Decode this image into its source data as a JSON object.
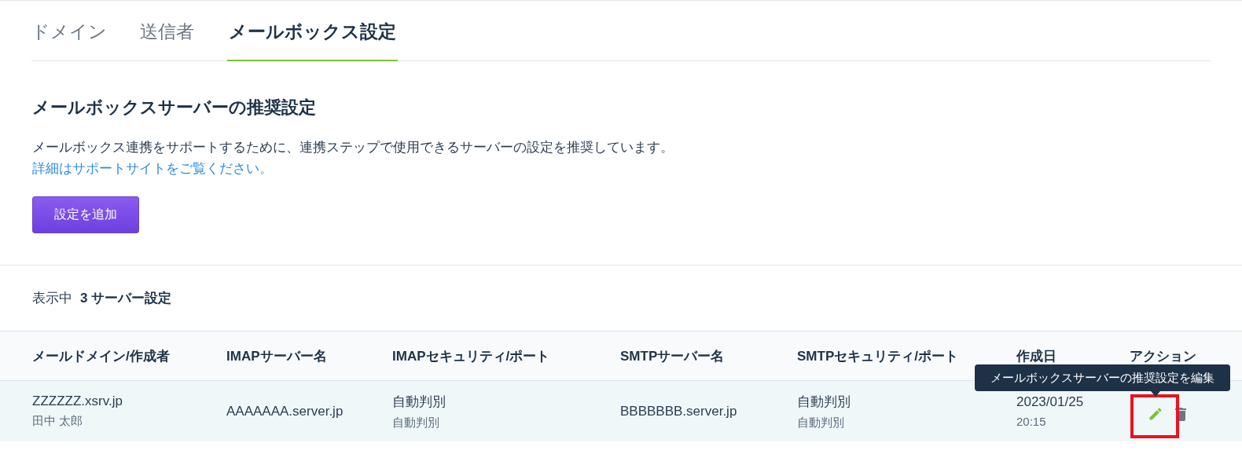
{
  "tabs": [
    {
      "label": "ドメイン",
      "selected": false
    },
    {
      "label": "送信者",
      "selected": false
    },
    {
      "label": "メールボックス設定",
      "selected": true
    }
  ],
  "section": {
    "title": "メールボックスサーバーの推奨設定",
    "description": "メールボックス連携をサポートするために、連携ステップで使用できるサーバーの設定を推奨しています。",
    "link": "詳細はサポートサイトをご覧ください。",
    "button": "設定を追加"
  },
  "count": {
    "label": "表示中",
    "value": "3 サーバー設定"
  },
  "table": {
    "columns": [
      "メールドメイン/作成者",
      "IMAPサーバー名",
      "IMAPセキュリティ/ポート",
      "SMTPサーバー名",
      "SMTPセキュリティ/ポート",
      "作成日",
      "アクション"
    ],
    "rows": [
      {
        "domain": "ZZZZZZ.xsrv.jp",
        "author": "田中 太郎",
        "imap_server": "AAAAAAA.server.jp",
        "imap_security": "自動判別",
        "imap_port": "自動判別",
        "smtp_server": "BBBBBBB.server.jp",
        "smtp_security": "自動判別",
        "smtp_port": "自動判別",
        "date": "2023/01/25",
        "time": "20:15",
        "highlighted": true
      }
    ]
  },
  "tooltip": "メールボックスサーバーの推奨設定を編集"
}
